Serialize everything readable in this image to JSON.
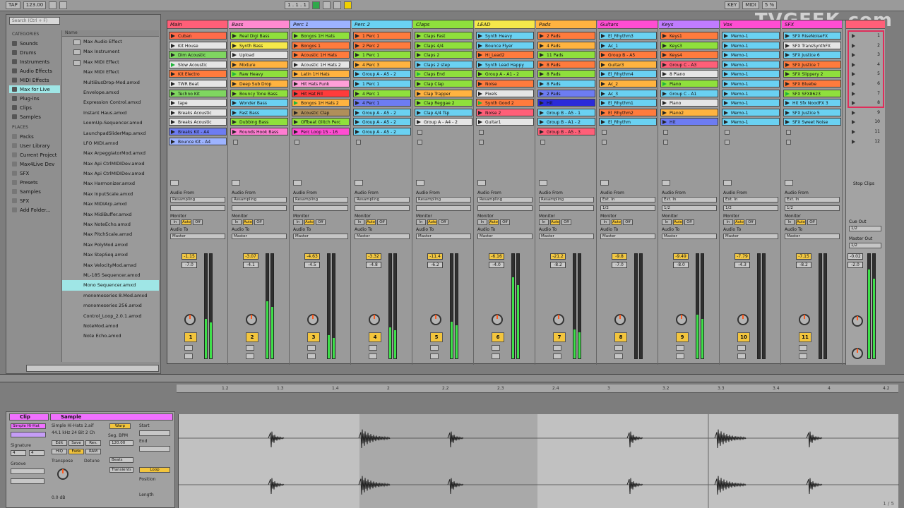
{
  "topbar": {
    "tap": "TAP",
    "tempo": "123.00",
    "bars": "1 . 1 . 1",
    "key_label": "KEY",
    "midi_label": "MIDI",
    "cpu": "5 %"
  },
  "watermark": "TVGEEK.com",
  "browser": {
    "search_placeholder": "Search (Ctrl + F)",
    "categories_header": "CATEGORIES",
    "categories": [
      "Sounds",
      "Drums",
      "Instruments",
      "Audio Effects",
      "MIDI Effects",
      "Max for Live",
      "Plug-ins",
      "Clips",
      "Samples"
    ],
    "places_header": "PLACES",
    "places": [
      "Packs",
      "User Library",
      "Current Project",
      "Max4Live Dev",
      "SFX",
      "Presets",
      "Samples",
      "SFX",
      "Add Folder..."
    ],
    "files_header": "Name",
    "files": [
      {
        "name": "Max Audio Effect",
        "folder": true
      },
      {
        "name": "Max Instrument",
        "folder": true
      },
      {
        "name": "Max MIDI Effect",
        "folder": true
      },
      {
        "name": "Max MIDI Effect",
        "folder": false
      },
      {
        "name": "MultiBusDrop-Mod.amxd",
        "folder": false
      },
      {
        "name": "Envelope.amxd",
        "folder": false
      },
      {
        "name": "Expression Control.amxd",
        "folder": false
      },
      {
        "name": "Instant Haus.amxd",
        "folder": false
      },
      {
        "name": "LoomUp-Sequencer.amxd",
        "folder": false
      },
      {
        "name": "LaunchpadSliderMap.amxd",
        "folder": false
      },
      {
        "name": "LFO MIDI.amxd",
        "folder": false
      },
      {
        "name": "Max ArpeggiatorMod.amxd",
        "folder": false
      },
      {
        "name": "Max Api CtrlMIDIDev.amxd",
        "folder": false
      },
      {
        "name": "Max Api CtrlMIDIDev.amxd",
        "folder": false
      },
      {
        "name": "Max Harmonizer.amxd",
        "folder": false
      },
      {
        "name": "Max InputScale.amxd",
        "folder": false
      },
      {
        "name": "Max MIDIArp.amxd",
        "folder": false
      },
      {
        "name": "Max MidiBuffer.amxd",
        "folder": false
      },
      {
        "name": "Max NoteEcho.amxd",
        "folder": false
      },
      {
        "name": "Max PitchScale.amxd",
        "folder": false
      },
      {
        "name": "Max PolyMod.amxd",
        "folder": false
      },
      {
        "name": "Max StepSeq.amxd",
        "folder": false
      },
      {
        "name": "Max VelocityMod.amxd",
        "folder": false
      },
      {
        "name": "ML-185 Sequencer.amxd",
        "folder": false
      },
      {
        "name": "Mono Sequencer.amxd",
        "folder": false,
        "selected": true
      },
      {
        "name": "monomeseries 8.Mod.amxd",
        "folder": false
      },
      {
        "name": "monomeseries 256.amxd",
        "folder": false
      },
      {
        "name": "Control_Loop_2.0.1.amxd",
        "folder": false
      },
      {
        "name": "NoteMod.amxd",
        "folder": false
      },
      {
        "name": "Note Echo.amxd",
        "folder": false
      }
    ]
  },
  "tracks": [
    {
      "name": "Main",
      "color": "#ff5f78",
      "clips": [
        [
          "Cuban",
          "#ff6b4a"
        ],
        [
          "Kit House",
          "#e5e5e5"
        ],
        [
          "Dim Acoustic",
          "#7fd660"
        ],
        [
          "Slow Acoustic",
          "#e5e5e5",
          true
        ],
        [
          "Kit Electro",
          "#ff7b3d"
        ],
        [
          "TWR Beat",
          "#e5e5e5"
        ],
        [
          "Techno Kit",
          "#7fd660"
        ],
        [
          "tape",
          "#e5e5e5"
        ],
        [
          "Breaks Acoustic",
          "#e5e5e5"
        ],
        [
          "Breaks Acoustic",
          "#e5e5e5"
        ],
        [
          "Breaks Kit - A4",
          "#6d7cf2"
        ],
        [
          "Bounce Kit - A4",
          "#9db3ff"
        ]
      ],
      "vol": "-1.15",
      "pan": "-7.0",
      "meter": 0.38,
      "num": "1"
    },
    {
      "name": "Bass",
      "color": "#ff8ad0",
      "clips": [
        [
          "Real Digi Bass",
          "#8fe03c"
        ],
        [
          "Synth Bass",
          "#f5e84a"
        ],
        [
          "Upload",
          "#e5e5e5"
        ],
        [
          "Mixture",
          "#ffb340"
        ],
        [
          "Raw Heavy",
          "#8fe03c",
          true
        ],
        [
          "Deep Sub Drop",
          "#ffb340"
        ],
        [
          "Bouncy Tone Bass",
          "#8fe03c"
        ],
        [
          "Wonder Bass",
          "#6ad1f2"
        ],
        [
          "Fast Bass",
          "#6ad1f2"
        ],
        [
          "Dubbing Bass",
          "#8fe03c"
        ],
        [
          "Rounds Hook Bass",
          "#ff7dd2"
        ]
      ],
      "vol": "-3.07",
      "pan": "-4.1",
      "meter": 0.55,
      "num": "2"
    },
    {
      "name": "Perc 1",
      "color": "#9db3ff",
      "clips": [
        [
          "Bongos 1H Hats",
          "#8fe03c"
        ],
        [
          "Bongos 1",
          "#ff7b3d"
        ],
        [
          "Acoustic 1H Hats",
          "#ff7b3d"
        ],
        [
          "Acoustic 1H Hats 2",
          "#e5e5e5"
        ],
        [
          "Latin 1H Hats",
          "#ffb340"
        ],
        [
          "Hit Hats Funk",
          "#ff9fd8"
        ],
        [
          "Hit Hat Fill",
          "#ff3b3b"
        ],
        [
          "Bongos 1H Hats 2",
          "#ffb340",
          true
        ],
        [
          "Acoustic Clap",
          "#b08f5a"
        ],
        [
          "Offbeat Glitch Perc",
          "#8fe03c"
        ],
        [
          "Perc Loop 15 - 16",
          "#ff4dd2"
        ]
      ],
      "vol": "-4.63",
      "pan": "-4.5",
      "meter": 0.22,
      "num": "3"
    },
    {
      "name": "Perc 2",
      "color": "#6ad1f2",
      "clips": [
        [
          "1 Perc 1",
          "#ff7b3d"
        ],
        [
          "2 Perc 2",
          "#ff7b3d"
        ],
        [
          "1 Perc 1",
          "#8fe03c"
        ],
        [
          "4 Perc 3",
          "#ffb340"
        ],
        [
          "Group A - A5 - 2",
          "#6ad1f2"
        ],
        [
          "1 Perc 1",
          "#6ad1f2"
        ],
        [
          "4 Perc 1",
          "#8fe03c"
        ],
        [
          "4 Perc 1",
          "#6d7cf2"
        ],
        [
          "Group A - A5 - 2",
          "#6ad1f2"
        ],
        [
          "Group A - A5 - 2",
          "#6ad1f2"
        ],
        [
          "Group A - A5 - 2",
          "#6ad1f2"
        ]
      ],
      "vol": "-3.32",
      "pan": "-4.8",
      "meter": 0.3,
      "num": "4"
    },
    {
      "name": "Claps",
      "color": "#8fe03c",
      "clips": [
        [
          "Claps Fast",
          "#8fe03c"
        ],
        [
          "Claps 4/4",
          "#8fe03c"
        ],
        [
          "Claps 2",
          "#8fe03c"
        ],
        [
          "Claps 2 step",
          "#6ad1f2"
        ],
        [
          "Claps End",
          "#8fe03c",
          true
        ],
        [
          "Clap Clap",
          "#8fe03c"
        ],
        [
          "Clap Trapper",
          "#ffb340"
        ],
        [
          "Clap Reggae 2",
          "#8fe03c"
        ],
        [
          "Clap 4/4 Tsp",
          "#6ad1f2"
        ],
        [
          "Group A - A4 - 2",
          "#e5e5e5"
        ]
      ],
      "vol": "-11.4",
      "pan": "-6.2",
      "meter": 0.35,
      "num": "5"
    },
    {
      "name": "LEAD",
      "color": "#f5e84a",
      "clips": [
        [
          "Synth Heavy",
          "#6ad1f2"
        ],
        [
          "Bounce Flyer",
          "#6ad1f2"
        ],
        [
          "Hi_Lead2",
          "#ff7b3d"
        ],
        [
          "Synth Lead Happy",
          "#6ad1f2"
        ],
        [
          "Group A - A1 - 2",
          "#8fe03c"
        ],
        [
          "Noise",
          "#ff7b3d"
        ],
        [
          "Pixels",
          "#e5e5e5"
        ],
        [
          "Synth Good 2",
          "#ff7b3d",
          true
        ],
        [
          "Noise 2",
          "#ff5f78"
        ],
        [
          "Guitar1",
          "#e5e5e5"
        ]
      ],
      "vol": "-6.16",
      "pan": "-4.0",
      "meter": 0.78,
      "num": "6"
    },
    {
      "name": "Pads",
      "color": "#ffb340",
      "clips": [
        [
          "2 Pads",
          "#ff7b3d"
        ],
        [
          "4 Pads",
          "#ffb340"
        ],
        [
          "11 Pads",
          "#8fe03c"
        ],
        [
          "8 Pads",
          "#ff7b3d"
        ],
        [
          "8 Pads",
          "#8fe03c"
        ],
        [
          "8 Pads",
          "#6ad1f2"
        ],
        [
          "2 Pads",
          "#6d7cf2"
        ],
        [
          "Hit",
          "#2b2bd9"
        ],
        [
          "Group B - A5 - 1",
          "#6ad1f2"
        ],
        [
          "Group B - A1 - 2",
          "#6ad1f2"
        ],
        [
          "Group B - A5 - 3",
          "#ff5f78"
        ]
      ],
      "vol": "-21.2",
      "pan": "-8.2",
      "meter": 0.28,
      "num": "7"
    },
    {
      "name": "Guitars",
      "color": "#ff4dd2",
      "clips": [
        [
          "El_Rhythm3",
          "#6ad1f2"
        ],
        [
          "Ac_1",
          "#6ad1f2"
        ],
        [
          "Group B - A5",
          "#ff7b3d"
        ],
        [
          "Guitar3",
          "#ffb340"
        ],
        [
          "El_Rhythm4",
          "#6ad1f2"
        ],
        [
          "Ac_2",
          "#ffb340"
        ],
        [
          "Ac_3",
          "#6ad1f2"
        ],
        [
          "El_Rhythm1",
          "#6ad1f2"
        ],
        [
          "El_Rhythm2",
          "#ff7b3d"
        ],
        [
          "El_Rhythm",
          "#6ad1f2"
        ]
      ],
      "vol": "-9.8",
      "pan": "-7.0",
      "meter": 0.0,
      "num": "8"
    },
    {
      "name": "Keys",
      "color": "#c07cff",
      "clips": [
        [
          "Keys1",
          "#ff7b3d"
        ],
        [
          "Keys3",
          "#8fe03c"
        ],
        [
          "Keys4",
          "#ff7b3d"
        ],
        [
          "Group C - A3",
          "#ff5f78"
        ],
        [
          "8 Piano",
          "#e5e5e5"
        ],
        [
          "Piano",
          "#8fe03c",
          true
        ],
        [
          "Group C - A1",
          "#6ad1f2"
        ],
        [
          "Piano",
          "#e5e5e5"
        ],
        [
          "Piano2",
          "#ffb340"
        ],
        [
          "Hit",
          "#6d7cf2"
        ]
      ],
      "vol": "-9.49",
      "pan": "-8.0",
      "meter": 0.42,
      "num": "9"
    },
    {
      "name": "Vox",
      "color": "#ff4dd2",
      "clips": [
        [
          "Memo-1",
          "#6ad1f2"
        ],
        [
          "Memo-1",
          "#6ad1f2"
        ],
        [
          "Memo-1",
          "#6ad1f2"
        ],
        [
          "Memo-1",
          "#6ad1f2"
        ],
        [
          "Memo-1",
          "#6ad1f2"
        ],
        [
          "Memo-1",
          "#6ad1f2"
        ],
        [
          "Memo-1",
          "#6ad1f2"
        ],
        [
          "Memo-1",
          "#6ad1f2"
        ],
        [
          "Memo-1",
          "#6ad1f2"
        ],
        [
          "Memo-1",
          "#6ad1f2"
        ]
      ],
      "vol": "-7.79",
      "pan": "-4.3",
      "meter": 0.0,
      "num": "10"
    },
    {
      "name": "SFX",
      "color": "#ff4dd2",
      "clips": [
        [
          "SFX RiseNoiseFX",
          "#6ad1f2"
        ],
        [
          "SFX TransSynthFX",
          "#e5e5e5"
        ],
        [
          "SFX Justice 6",
          "#6ad1f2"
        ],
        [
          "SFX Justice 7",
          "#ff7b3d"
        ],
        [
          "SFX Slippery 2",
          "#8fe03c"
        ],
        [
          "SFX Bluebe",
          "#ff7b3d"
        ],
        [
          "SFX SFX8623",
          "#8fe03c",
          true
        ],
        [
          "Hit Sfx NoodFX 3",
          "#6ad1f2"
        ],
        [
          "SFX Justice 5",
          "#6ad1f2"
        ],
        [
          "SFX Sweet Noise",
          "#6ad1f2"
        ]
      ],
      "vol": "-7.15",
      "pan": "-8.2",
      "meter": 0.0,
      "num": "11"
    }
  ],
  "io": {
    "audio_from_label": "Audio From",
    "audio_from_value": "Resampling",
    "ext_in_value": "Ext. In",
    "channel_value": "1/2",
    "monitor_label": "Monitor",
    "in_label": "In",
    "auto_label": "Auto",
    "off_label": "Off",
    "audio_to_label": "Audio To",
    "audio_to_value": "Master"
  },
  "master": {
    "scenes": [
      "1",
      "2",
      "3",
      "4",
      "5",
      "6",
      "7",
      "8",
      "9",
      "10",
      "11",
      "12"
    ],
    "stop_clips": "Stop Clips",
    "cue_out_label": "Cue Out",
    "cue_out_value": "1/2",
    "master_out_label": "Master Out",
    "master_out_value": "1/2",
    "vol": "-0.02",
    "pan": "-2.0",
    "meter": 0.85
  },
  "ruler": [
    "1.2",
    "1.3",
    "1.4",
    "2",
    "2.2",
    "2.3",
    "2.4",
    "3",
    "3.2",
    "3.3",
    "3.4",
    "4",
    "4.2"
  ],
  "clip_view": {
    "clip_title": "Clip",
    "sample_title": "Sample",
    "clip_name": "Simple Hi-Hat",
    "sample_name": "Simple Hi-Hats 2.aif",
    "sample_info": "44.1 kHz 24 Bit 2 Ch",
    "warp_label": "Warp",
    "start_label": "Start",
    "end_label": "End",
    "signature_label": "Signature",
    "sig_num": "4",
    "sig_den": "4",
    "groove_label": "Groove",
    "hiq_label": "HiQ",
    "fade_label": "Fade",
    "ram_label": "RAM",
    "edit_label": "Edit",
    "save_label": "Save",
    "rev_label": "Rev.",
    "seg_bpm_label": "Seg. BPM",
    "seg_bpm_value": "120.00",
    "transpose_label": "Transpose",
    "detune_label": "Detune",
    "loop_label": "Loop",
    "position_label": "Position",
    "length_label": "Length",
    "mode_value": "Beats",
    "transients_value": "Transients",
    "db_value": "0.0 dB"
  },
  "page_number": "1 / 5"
}
